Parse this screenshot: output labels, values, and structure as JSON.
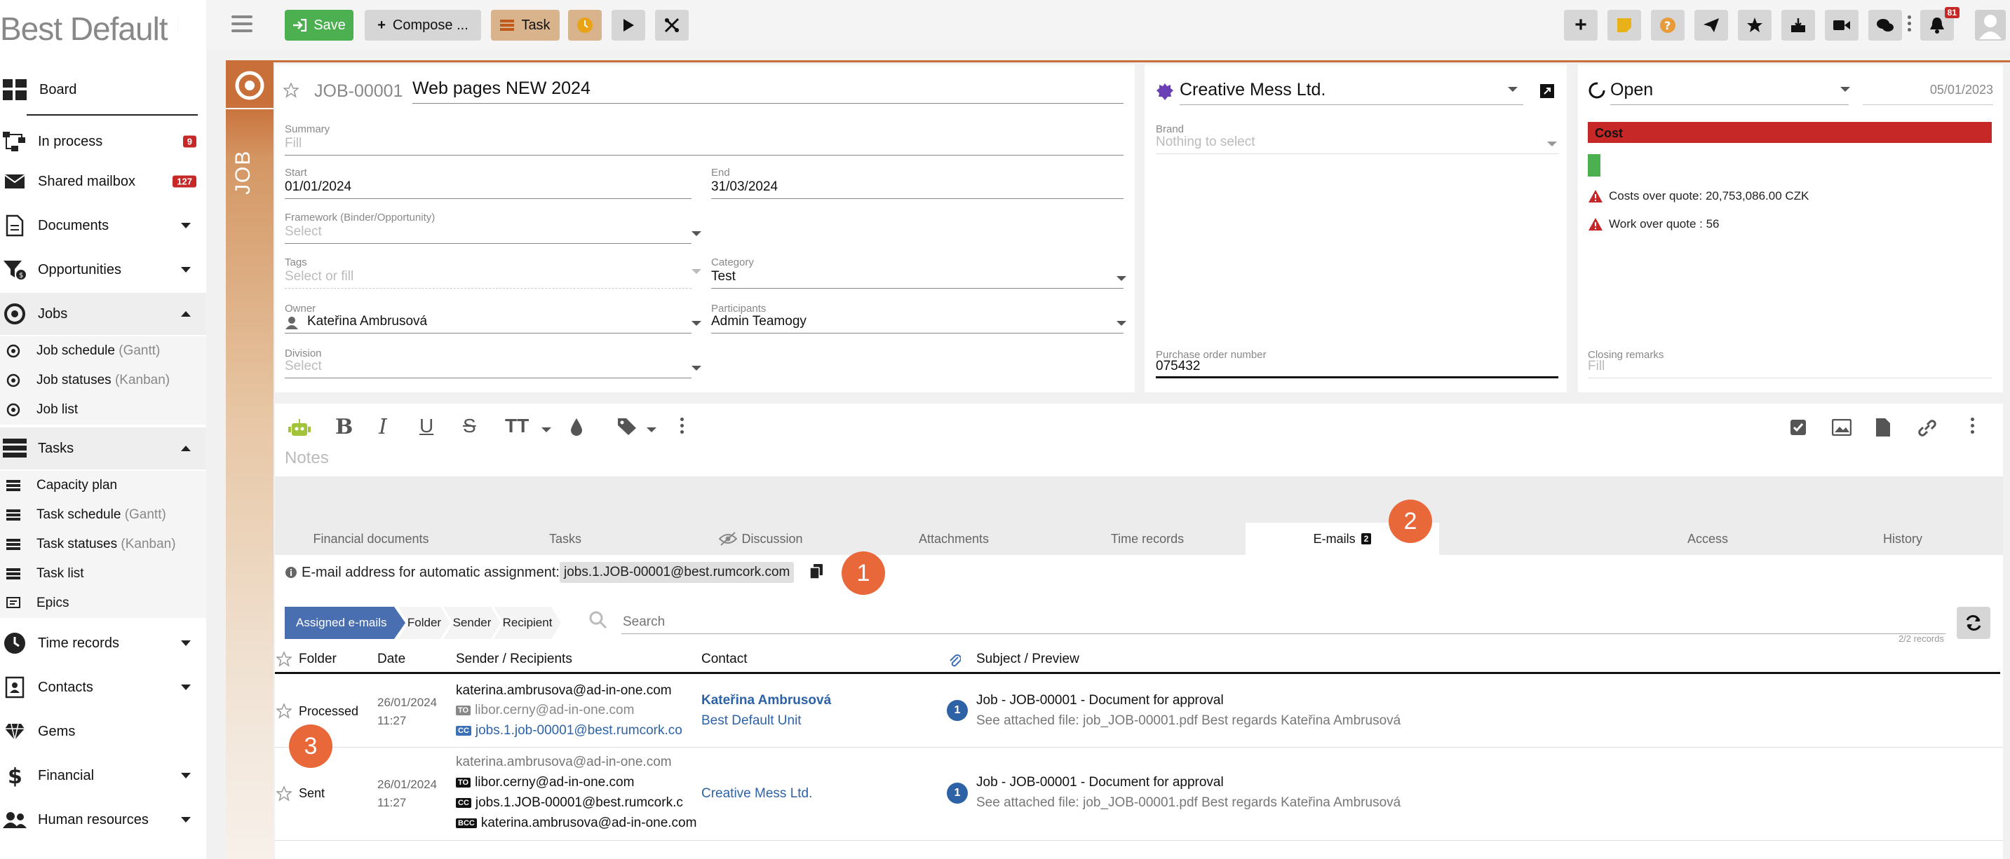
{
  "sidebar": {
    "logo": "Best Default Unit",
    "items": [
      {
        "label": "Board"
      },
      {
        "label": "In process",
        "count": "9"
      },
      {
        "label": "Shared mailbox",
        "count": "127"
      },
      {
        "label": "Documents"
      },
      {
        "label": "Opportunities"
      },
      {
        "label": "Jobs"
      },
      {
        "label": "Job schedule",
        "suffix": "(Gantt)"
      },
      {
        "label": "Job statuses",
        "suffix": "(Kanban)"
      },
      {
        "label": "Job list"
      },
      {
        "label": "Tasks"
      },
      {
        "label": "Capacity plan"
      },
      {
        "label": "Task schedule",
        "suffix": "(Gantt)"
      },
      {
        "label": "Task statuses",
        "suffix": "(Kanban)"
      },
      {
        "label": "Task list"
      },
      {
        "label": "Epics"
      },
      {
        "label": "Time records"
      },
      {
        "label": "Contacts"
      },
      {
        "label": "Gems"
      },
      {
        "label": "Financial"
      },
      {
        "label": "Human resources"
      }
    ]
  },
  "toolbar": {
    "save": "Save",
    "compose": "Compose ...",
    "task": "Task",
    "notification_count": "81"
  },
  "job": {
    "strip_label": "JOB",
    "number": "JOB-00001",
    "title": "Web pages NEW 2024",
    "summary_label": "Summary",
    "summary_placeholder": "Fill",
    "start_label": "Start",
    "start": "01/01/2024",
    "end_label": "End",
    "end": "31/03/2024",
    "framework_label": "Framework (Binder/Opportunity)",
    "framework_placeholder": "Select",
    "tags_label": "Tags",
    "tags_placeholder": "Select or fill",
    "category_label": "Category",
    "category": "Test",
    "owner_label": "Owner",
    "owner": "Kateřina Ambrusová",
    "participants_label": "Participants",
    "participants": "Admin Teamogy",
    "division_label": "Division",
    "division_placeholder": "Select"
  },
  "company": {
    "name": "Creative Mess Ltd.",
    "brand_label": "Brand",
    "brand_placeholder": "Nothing to select",
    "po_label": "Purchase order number",
    "po_value": "075432"
  },
  "status": {
    "state": "Open",
    "date": "05/01/2023",
    "cost_label": "Cost",
    "warning1": "Costs over quote: 20,753,086.00 CZK",
    "warning2": "Work over quote : 56",
    "closing_label": "Closing remarks",
    "closing_placeholder": "Fill"
  },
  "notes": {
    "placeholder": "Notes"
  },
  "tabs": [
    {
      "label": "Financial documents"
    },
    {
      "label": "Tasks"
    },
    {
      "label": "Discussion"
    },
    {
      "label": "Attachments"
    },
    {
      "label": "Time records"
    },
    {
      "label": "E-mails",
      "count": "2"
    },
    {
      "label": "Access"
    },
    {
      "label": "History"
    }
  ],
  "emails": {
    "auto_label": "E-mail address for automatic assignment:",
    "auto_address": "jobs.1.JOB-00001@best.rumcork.com",
    "filters": [
      "Assigned e-mails",
      "Folder",
      "Sender",
      "Recipient"
    ],
    "search_placeholder": "Search",
    "records": "2/2 records",
    "columns": [
      "Folder",
      "Date",
      "Sender / Recipients",
      "Contact",
      "Subject / Preview"
    ],
    "rows": [
      {
        "folder": "Processed",
        "date": "26/01/2024",
        "time": "11:27",
        "from": "katerina.ambrusova@ad-in-one.com",
        "to": "libor.cerny@ad-in-one.com",
        "cc": "jobs.1.job-00001@best.rumcork.co",
        "contact": "Kateřina Ambrusová",
        "contact_sub": "Best Default Unit",
        "count": "1",
        "subject": "Job - JOB-00001 - Document for approval",
        "preview": "See attached file: job_JOB-00001.pdf Best regards Kateřina Ambrusová"
      },
      {
        "folder": "Sent",
        "date": "26/01/2024",
        "time": "11:27",
        "from": "katerina.ambrusova@ad-in-one.com",
        "to": "libor.cerny@ad-in-one.com",
        "cc": "jobs.1.JOB-00001@best.rumcork.c",
        "bcc": "katerina.ambrusova@ad-in-one.com",
        "contact": "Creative Mess Ltd.",
        "count": "1",
        "subject": "Job - JOB-00001 - Document for approval",
        "preview": "See attached file: job_JOB-00001.pdf Best regards Kateřina Ambrusová"
      }
    ]
  },
  "callouts": [
    "1",
    "2",
    "3"
  ],
  "colors": {
    "accent": "#c9703a",
    "save_green": "#4caf50",
    "cost_red": "#c62828",
    "link_blue": "#2e62a6",
    "callout": "#e9683a"
  }
}
